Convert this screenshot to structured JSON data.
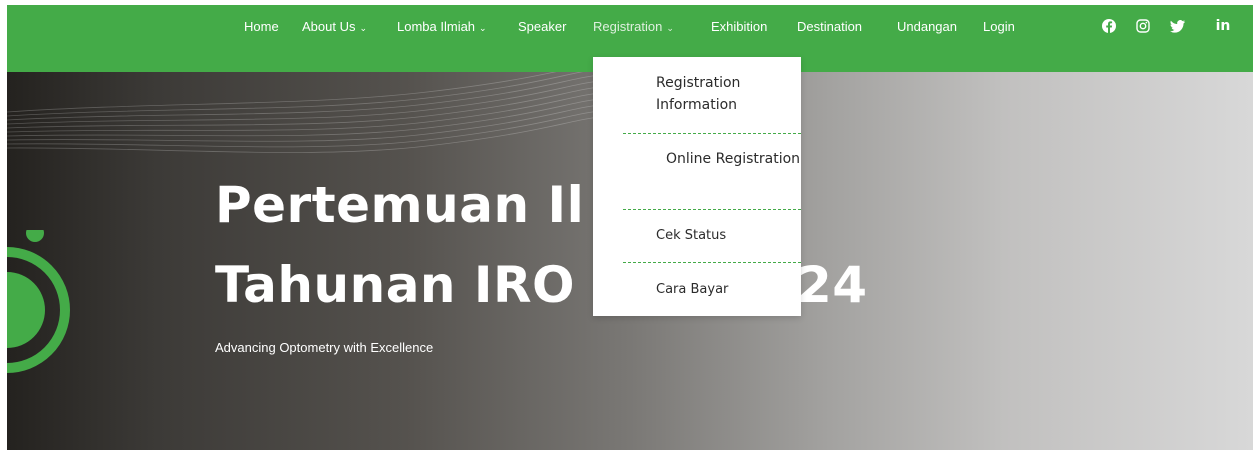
{
  "nav": {
    "items": [
      {
        "label": "Home"
      },
      {
        "label": "About Us",
        "chevron": "⌄"
      },
      {
        "label": "Lomba Ilmiah",
        "chevron": "⌄"
      },
      {
        "label": "Speaker"
      },
      {
        "label": "Registration",
        "chevron": "⌄"
      },
      {
        "label": "Exhibition"
      },
      {
        "label": "Destination"
      },
      {
        "label": "Undangan"
      },
      {
        "label": "Login"
      }
    ],
    "social_icons": [
      "facebook-icon",
      "instagram-icon",
      "twitter-icon",
      "linkedin-icon"
    ],
    "linkedin_glyph": "in"
  },
  "dropdown": {
    "items": [
      {
        "label": "Registration Information"
      },
      {
        "label": "Online Registration"
      },
      {
        "label": "Cek Status"
      },
      {
        "label": "Cara Bayar"
      }
    ]
  },
  "hero": {
    "title_line1": "Pertemuan Il",
    "title_line2": "Tahunan IRO",
    "title_suffix": "24",
    "subtitle": "Advancing Optometry with Excellence"
  },
  "colors": {
    "brand_green": "#44ab48",
    "dropdown_bg": "#ffffff"
  }
}
